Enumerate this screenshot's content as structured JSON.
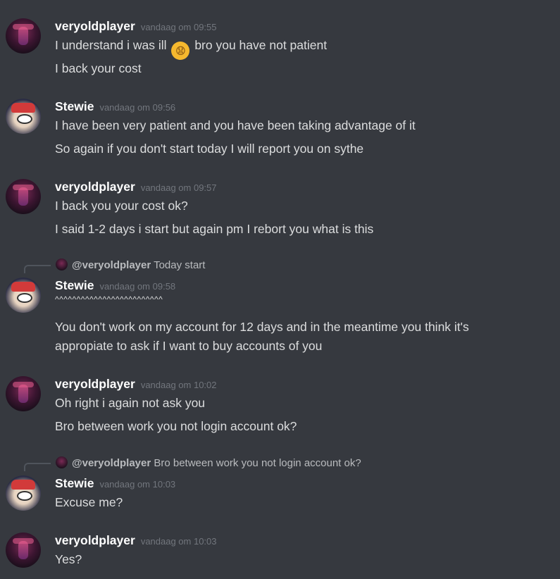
{
  "messages": [
    {
      "author": "veryoldplayer",
      "timestamp": "vandaag om 09:55",
      "lines": [
        "I understand i was ill",
        "I back your cost"
      ],
      "emoji_after_text": "bro you have not patient",
      "emoji_icon": "sneezing-face-icon"
    },
    {
      "author": "Stewie",
      "timestamp": "vandaag om 09:56",
      "lines": [
        "I have been very patient and you have been taking advantage of it",
        "So again if you don't start today I will report you on sythe"
      ]
    },
    {
      "author": "veryoldplayer",
      "timestamp": "vandaag om 09:57",
      "lines": [
        "I back you your cost ok?",
        "I said 1-2 days i start but again pm I rebort you what is this"
      ]
    },
    {
      "author": "Stewie",
      "timestamp": "vandaag om 09:58",
      "reply": {
        "author": "@veryoldplayer",
        "text": "Today start"
      },
      "lines": [
        "^^^^^^^^^^^^^^^^^^^^^^^^^",
        "You don't work on my account for 12 days and in the meantime you think it's",
        "appropiate to ask if I want to buy accounts of you"
      ]
    },
    {
      "author": "veryoldplayer",
      "timestamp": "vandaag om 10:02",
      "lines": [
        "Oh right i again not ask you",
        "Bro between  work  you not login account ok?"
      ]
    },
    {
      "author": "Stewie",
      "timestamp": "vandaag om 10:03",
      "reply": {
        "author": "@veryoldplayer",
        "text": "Bro between  work  you not login account ok?"
      },
      "lines": [
        "Excuse me?"
      ]
    },
    {
      "author": "veryoldplayer",
      "timestamp": "vandaag om 10:03",
      "lines": [
        "Yes?"
      ]
    }
  ]
}
